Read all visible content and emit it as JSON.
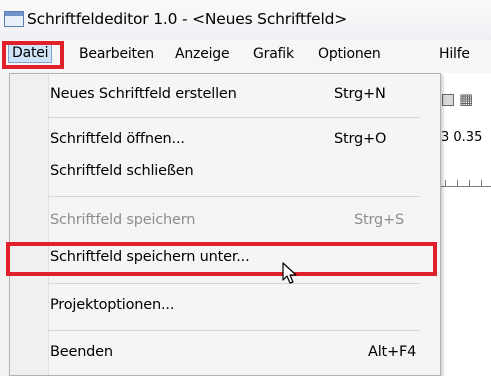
{
  "window": {
    "title": "Schriftfeldeditor 1.0 - <Neues Schriftfeld>"
  },
  "menubar": {
    "items": [
      "Datei",
      "Bearbeiten",
      "Anzeige",
      "Grafik",
      "Optionen",
      "Hilfe"
    ],
    "active": "Datei"
  },
  "toolbar": {
    "field_value": "3  0.35"
  },
  "file_menu": {
    "items": [
      {
        "label": "Neues Schriftfeld erstellen",
        "shortcut": "Strg+N",
        "enabled": true
      },
      {
        "label": "Schriftfeld öffnen...",
        "shortcut": "Strg+O",
        "enabled": true
      },
      {
        "label": "Schriftfeld schließen",
        "shortcut": "",
        "enabled": true
      },
      {
        "label": "Schriftfeld speichern",
        "shortcut": "Strg+S",
        "enabled": false
      },
      {
        "label": "Schriftfeld speichern unter...",
        "shortcut": "",
        "enabled": true,
        "highlighted": true
      },
      {
        "label": "Projektoptionen...",
        "shortcut": "",
        "enabled": true
      },
      {
        "label": "Beenden",
        "shortcut": "Alt+F4",
        "enabled": true
      }
    ]
  },
  "colors": {
    "highlight_outline": "#e2202a",
    "menu_active_bg": "#cfe4f9",
    "disabled_text": "#8d8d8d"
  }
}
